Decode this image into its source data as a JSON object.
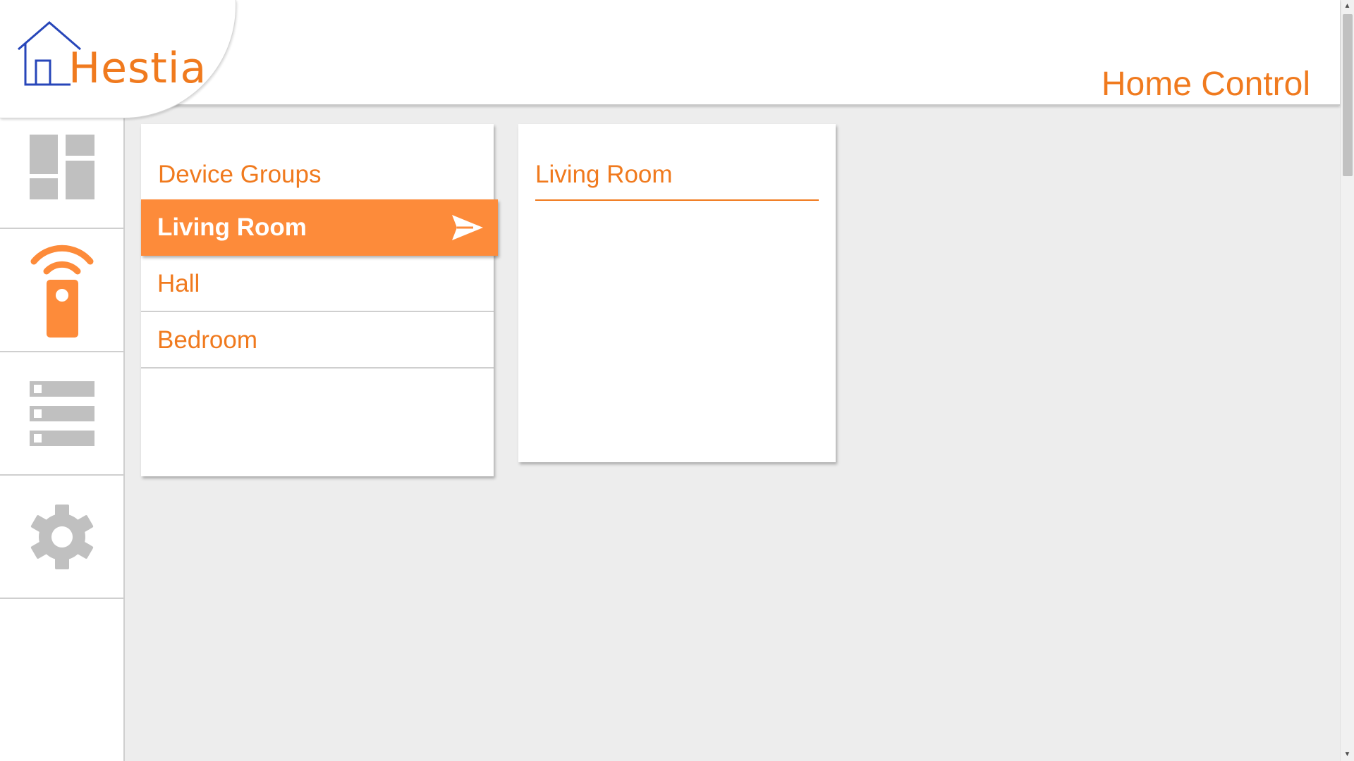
{
  "app": {
    "brand": "Hestia",
    "page_title": "Home Control",
    "accent_color": "#f07a1e",
    "active_color": "#fd8b3a"
  },
  "sidebar": {
    "items": [
      {
        "name": "dashboard",
        "icon": "dashboard-icon",
        "active": false
      },
      {
        "name": "remote-control",
        "icon": "remote-control-icon",
        "active": true
      },
      {
        "name": "list",
        "icon": "list-icon",
        "active": false
      },
      {
        "name": "settings",
        "icon": "gear-icon",
        "active": false
      }
    ]
  },
  "device_groups": {
    "title": "Device Groups",
    "items": [
      {
        "label": "Living Room",
        "selected": true
      },
      {
        "label": "Hall",
        "selected": false
      },
      {
        "label": "Bedroom",
        "selected": false
      }
    ]
  },
  "detail": {
    "title": "Living Room"
  }
}
